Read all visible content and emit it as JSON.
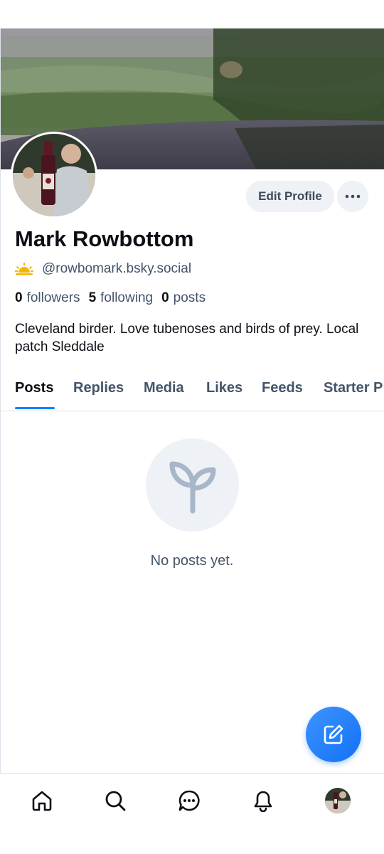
{
  "profile": {
    "display_name": "Mark Rowbottom",
    "handle": "@rowbomark.bsky.social",
    "handle_badge_icon": "sunrise-emoji-icon",
    "bio": "Cleveland birder. Love tubenoses and birds of prey. Local patch Sleddale",
    "stats": {
      "followers_count": "0",
      "followers_label": "followers",
      "following_count": "5",
      "following_label": "following",
      "posts_count": "0",
      "posts_label": "posts"
    }
  },
  "actions": {
    "edit_profile_label": "Edit Profile",
    "more_icon": "ellipsis-icon"
  },
  "tabs": [
    {
      "label": "Posts",
      "active": true
    },
    {
      "label": "Replies",
      "active": false
    },
    {
      "label": "Media",
      "active": false
    },
    {
      "label": "Likes",
      "active": false
    },
    {
      "label": "Feeds",
      "active": false
    },
    {
      "label": "Starter P",
      "active": false
    }
  ],
  "empty_state": {
    "icon": "seedling-icon",
    "text": "No posts yet."
  },
  "fab": {
    "icon": "compose-icon"
  },
  "bottom_nav": [
    {
      "icon": "home-icon"
    },
    {
      "icon": "search-icon"
    },
    {
      "icon": "chat-icon"
    },
    {
      "icon": "bell-icon"
    },
    {
      "icon": "profile-avatar"
    }
  ],
  "colors": {
    "accent": "#1083fe",
    "muted_text": "#44546a",
    "button_bg": "#eef1f5"
  }
}
